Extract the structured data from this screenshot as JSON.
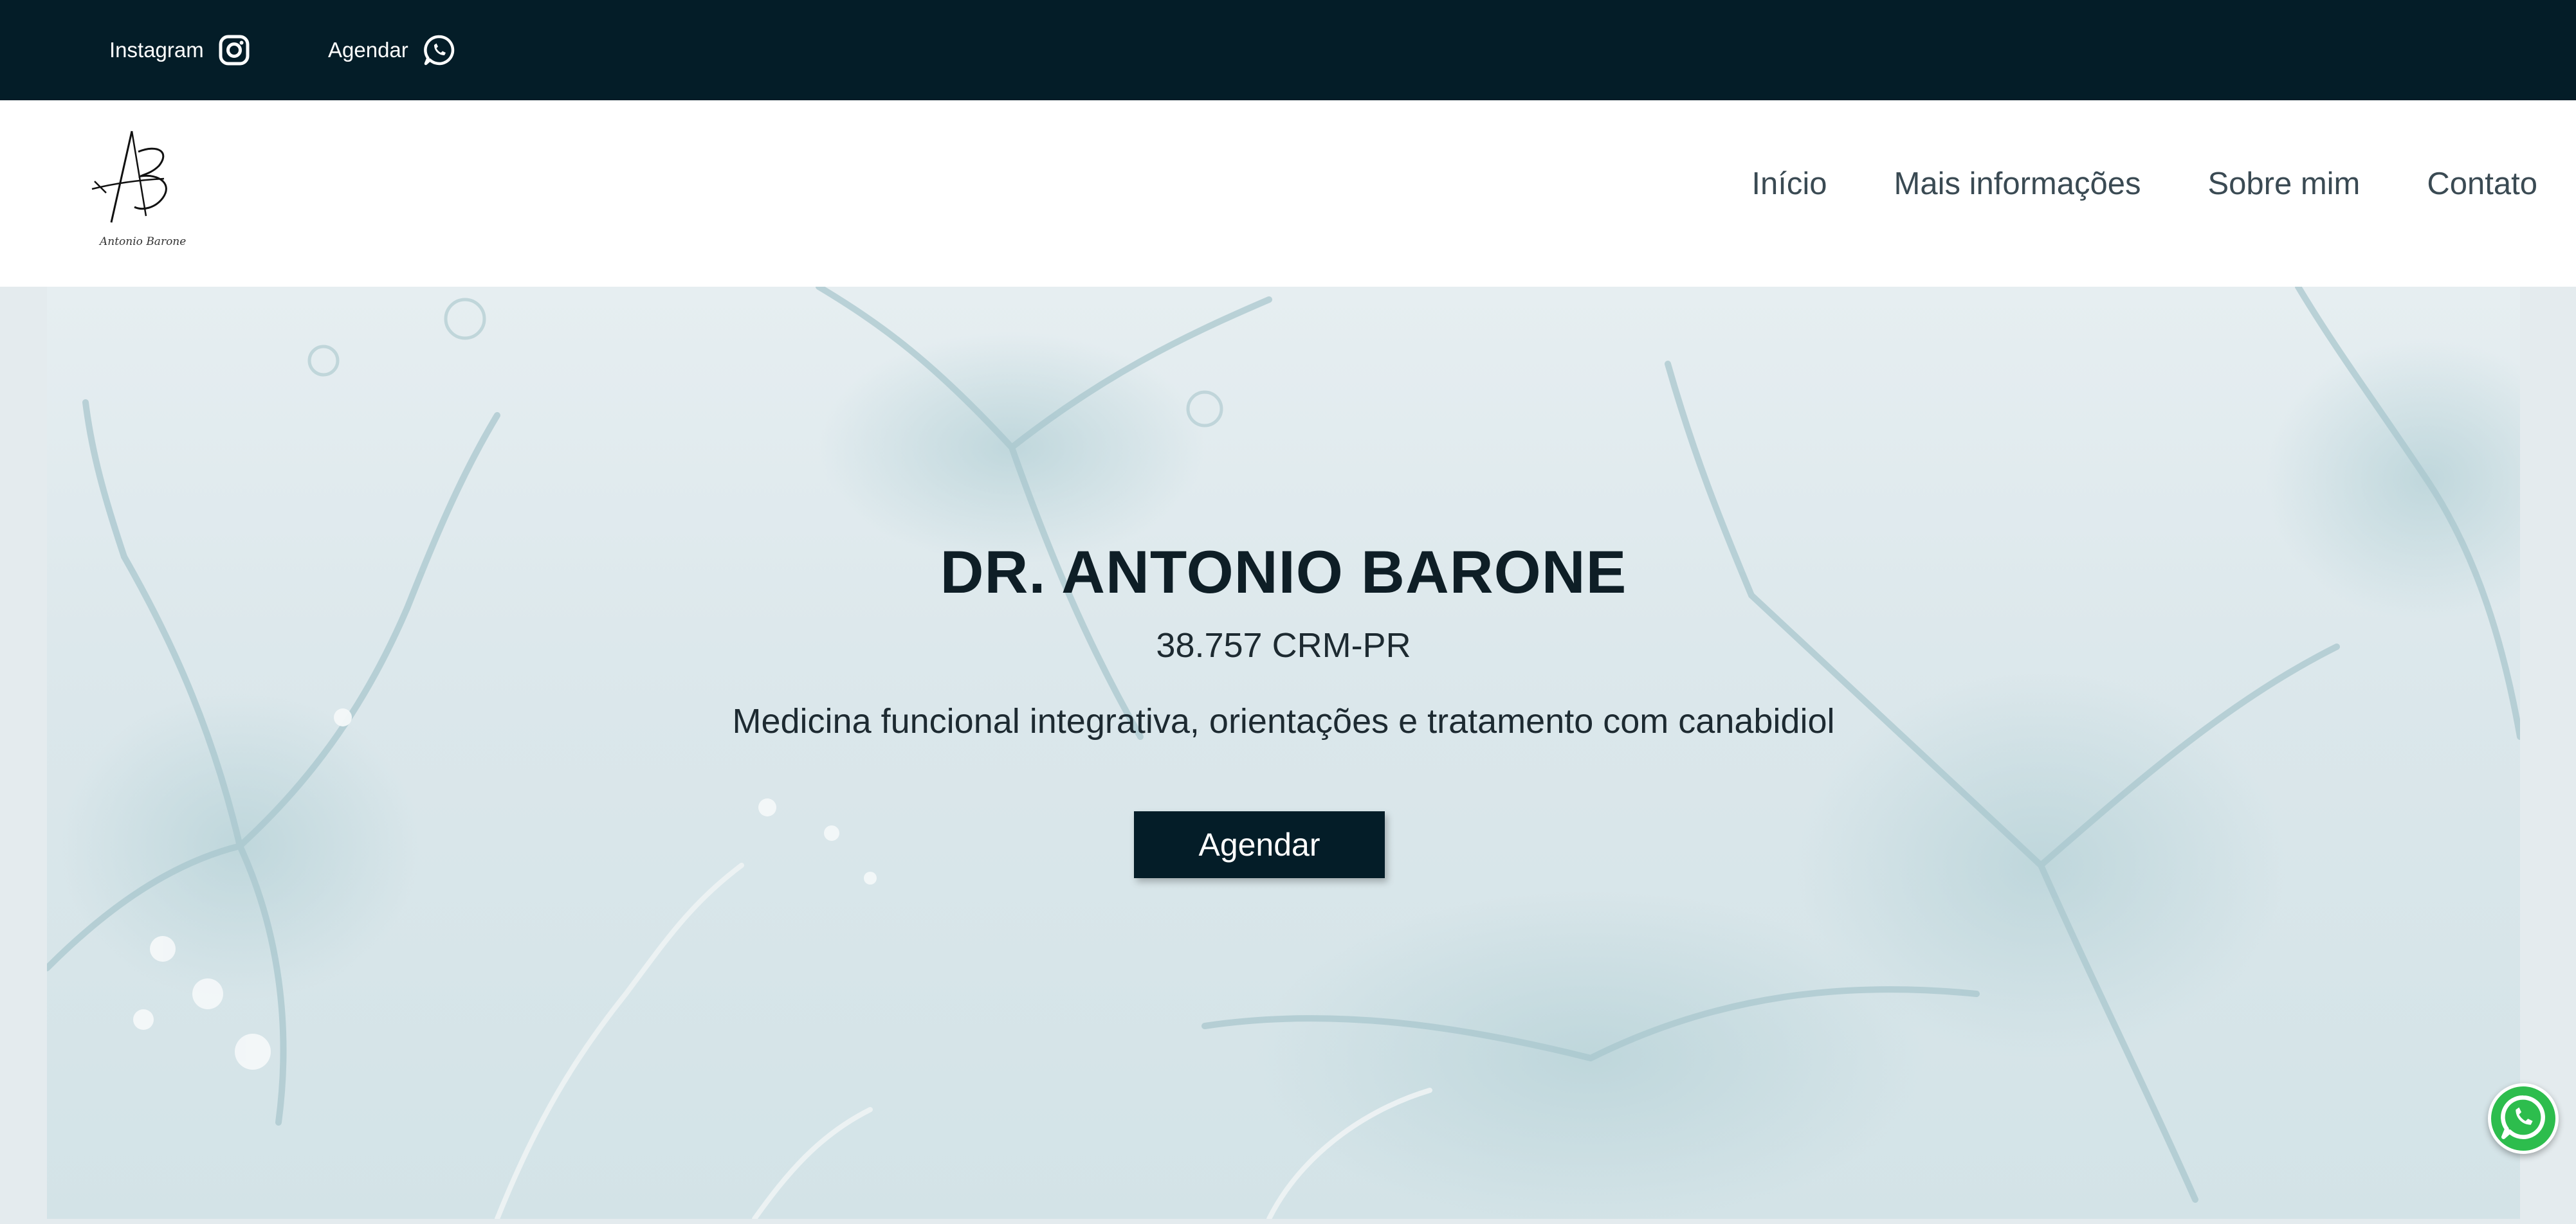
{
  "topbar": {
    "instagram_label": "Instagram",
    "agendar_label": "Agendar",
    "instagram_icon": "instagram-icon",
    "whatsapp_icon": "whatsapp-icon",
    "background_color": "#041d28"
  },
  "header": {
    "logo_caption": "Antonio Barone",
    "nav": [
      {
        "label": "Início"
      },
      {
        "label": "Mais informações"
      },
      {
        "label": "Sobre mim"
      },
      {
        "label": "Contato"
      }
    ]
  },
  "hero": {
    "title": "DR. ANTONIO BARONE",
    "crm": "38.757 CRM-PR",
    "subtitle": "Medicina funcional integrativa, orientações e tratamento com canabidiol",
    "button_label": "Agendar"
  },
  "floating": {
    "whatsapp_icon": "whatsapp-icon",
    "color": "#2dbd4d"
  }
}
